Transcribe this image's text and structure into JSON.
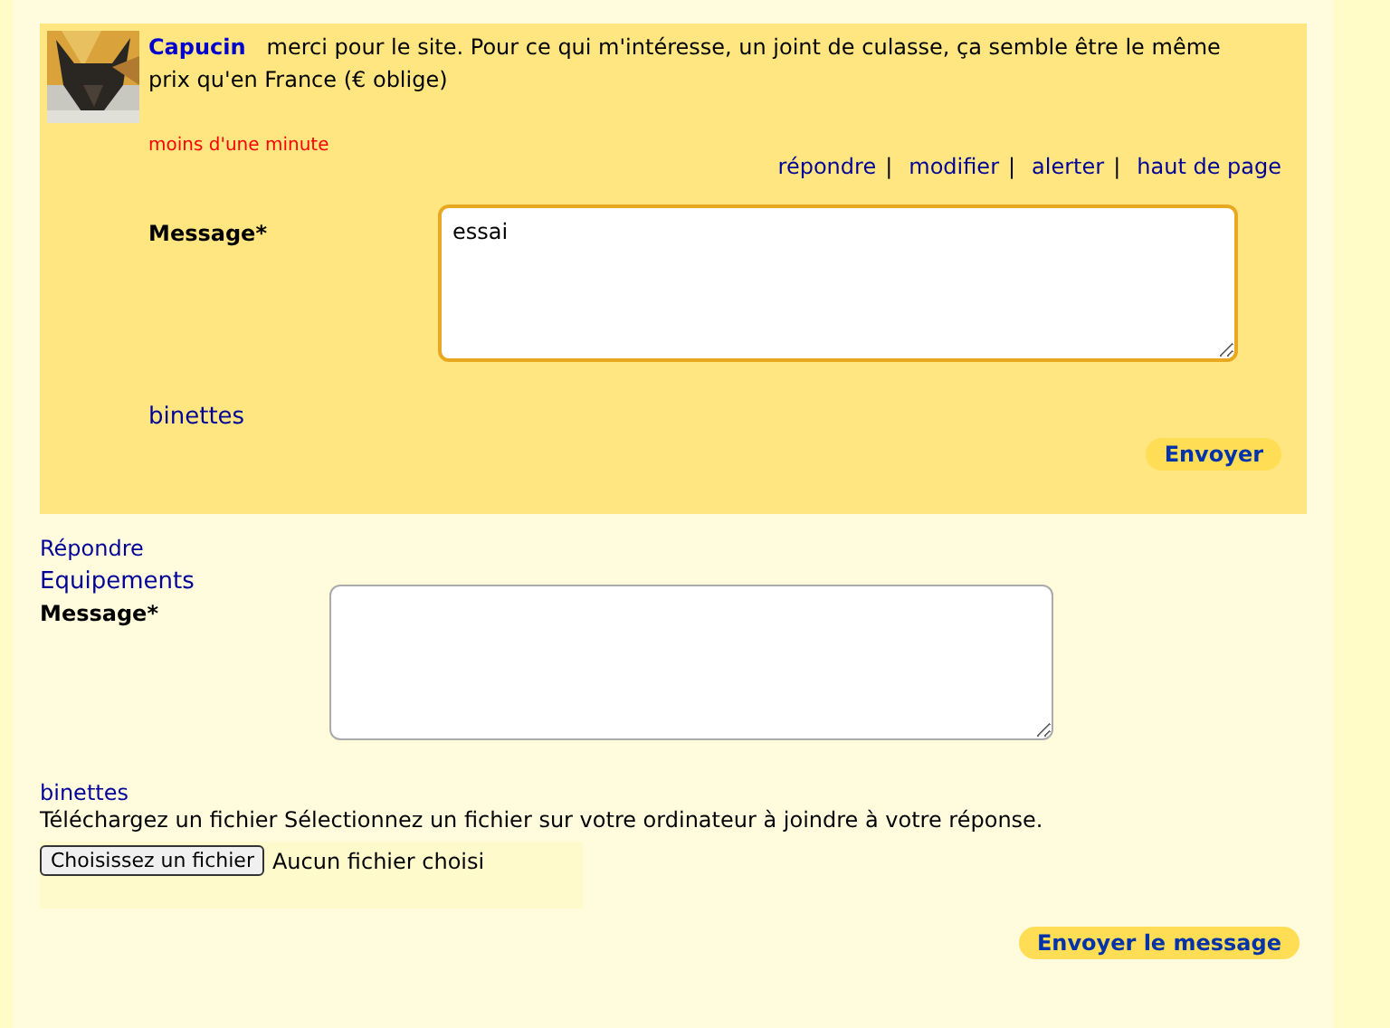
{
  "post": {
    "author": "Capucin",
    "text": "merci pour le site. Pour ce qui m'intéresse, un joint de culasse, ça semble être le même prix qu'en France (€ oblige)",
    "time": "moins d'une minute",
    "separator": "|",
    "actions": [
      "répondre",
      "modifier",
      "alerter",
      "haut de page"
    ],
    "reply_form": {
      "label": "Message*",
      "value": "essai",
      "focused": true,
      "smileys": "binettes",
      "button": "Envoyer"
    }
  },
  "reply": {
    "link": "Répondre",
    "forum": "Equipements",
    "label": "Message*",
    "focused": false,
    "smileys": "binettes",
    "upload_text": "Téléchargez un fichier Sélectionnez un fichier sur votre ordinateur à joindre à votre réponse.",
    "file_button": "Choisissez un fichier",
    "file_status": "Aucun fichier choisi",
    "submit": "Envoyer le message"
  }
}
